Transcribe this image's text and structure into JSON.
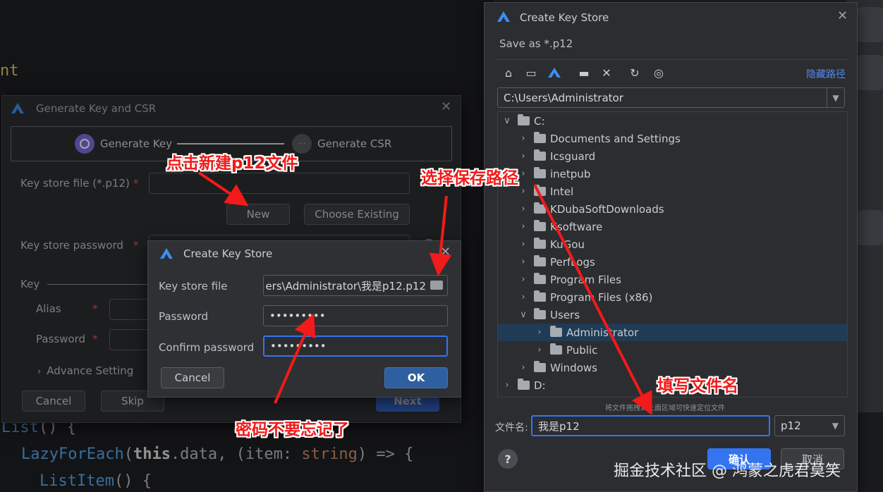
{
  "code": {
    "line1": "nt",
    "line2_kw": "List",
    "line2_rest": "() {",
    "line3_fn": "LazyForEach",
    "line3_open": "(",
    "line3_this": "this",
    "line3_mid": ".data, (item: ",
    "line3_type": "string",
    "line3_end": ") => {",
    "line4_fn": "ListItem",
    "line4_rest": "() {"
  },
  "generate_dialog": {
    "title": "Generate Key and CSR",
    "step1": "Generate Key",
    "step2": "Generate CSR",
    "keystore_label": "Key store file (*.p12)",
    "new_button": "New",
    "choose_button": "Choose Existing",
    "password_label": "Key store password",
    "key_section": "Key",
    "alias_label": "Alias",
    "key_password_label": "Password",
    "advance": "Advance Setting",
    "cancel": "Cancel",
    "skip": "Skip",
    "next": "Next",
    "required_mark": "*"
  },
  "create_small": {
    "title": "Create Key Store",
    "keystore_label": "Key store file",
    "keystore_value": "ers\\Administrator\\我是p12.p12",
    "password_label": "Password",
    "password_value": "•••••••••",
    "confirm_label": "Confirm password",
    "confirm_value": "•••••••••",
    "cancel": "Cancel",
    "ok": "OK"
  },
  "file_dialog": {
    "title": "Create Key Store",
    "subtitle": "Save as *.p12",
    "hide_path": "隐藏路径",
    "path": "C:\\Users\\Administrator",
    "tree": [
      {
        "label": "C:",
        "chevron": "∨",
        "indent": 0
      },
      {
        "label": "Documents and Settings",
        "chevron": "›",
        "indent": 1
      },
      {
        "label": "Icsguard",
        "chevron": "›",
        "indent": 1
      },
      {
        "label": "inetpub",
        "chevron": "›",
        "indent": 1
      },
      {
        "label": "Intel",
        "chevron": "›",
        "indent": 1
      },
      {
        "label": "KDubaSoftDownloads",
        "chevron": "›",
        "indent": 1
      },
      {
        "label": "Ksoftware",
        "chevron": "›",
        "indent": 1
      },
      {
        "label": "KuGou",
        "chevron": "›",
        "indent": 1
      },
      {
        "label": "PerfLogs",
        "chevron": "›",
        "indent": 1
      },
      {
        "label": "Program Files",
        "chevron": "›",
        "indent": 1
      },
      {
        "label": "Program Files (x86)",
        "chevron": "›",
        "indent": 1
      },
      {
        "label": "Users",
        "chevron": "∨",
        "indent": 1
      },
      {
        "label": "Administrator",
        "chevron": "›",
        "indent": 2,
        "selected": true
      },
      {
        "label": "Public",
        "chevron": "›",
        "indent": 2
      },
      {
        "label": "Windows",
        "chevron": "›",
        "indent": 1
      },
      {
        "label": "D:",
        "chevron": "›",
        "indent": 0
      }
    ],
    "drag_hint": "将文件拖拽到上面区域可快速定位文件",
    "filename_label": "文件名:",
    "filename_value": "我是p12",
    "filetype_value": "p12",
    "confirm": "确认",
    "cancel": "取消",
    "help": "?"
  },
  "annotations": {
    "click_new": "点击新建p12文件",
    "choose_path": "选择保存路径",
    "fill_name": "填写文件名",
    "remember_password": "密码不要忘记了"
  },
  "watermark": "掘金技术社区 @ 鸿蒙之虎君莫笑",
  "colors": {
    "accent": "#3574f0",
    "annotation": "#f21a1a",
    "dialog_bg": "#2b2d30",
    "selection": "#1f3b55"
  }
}
